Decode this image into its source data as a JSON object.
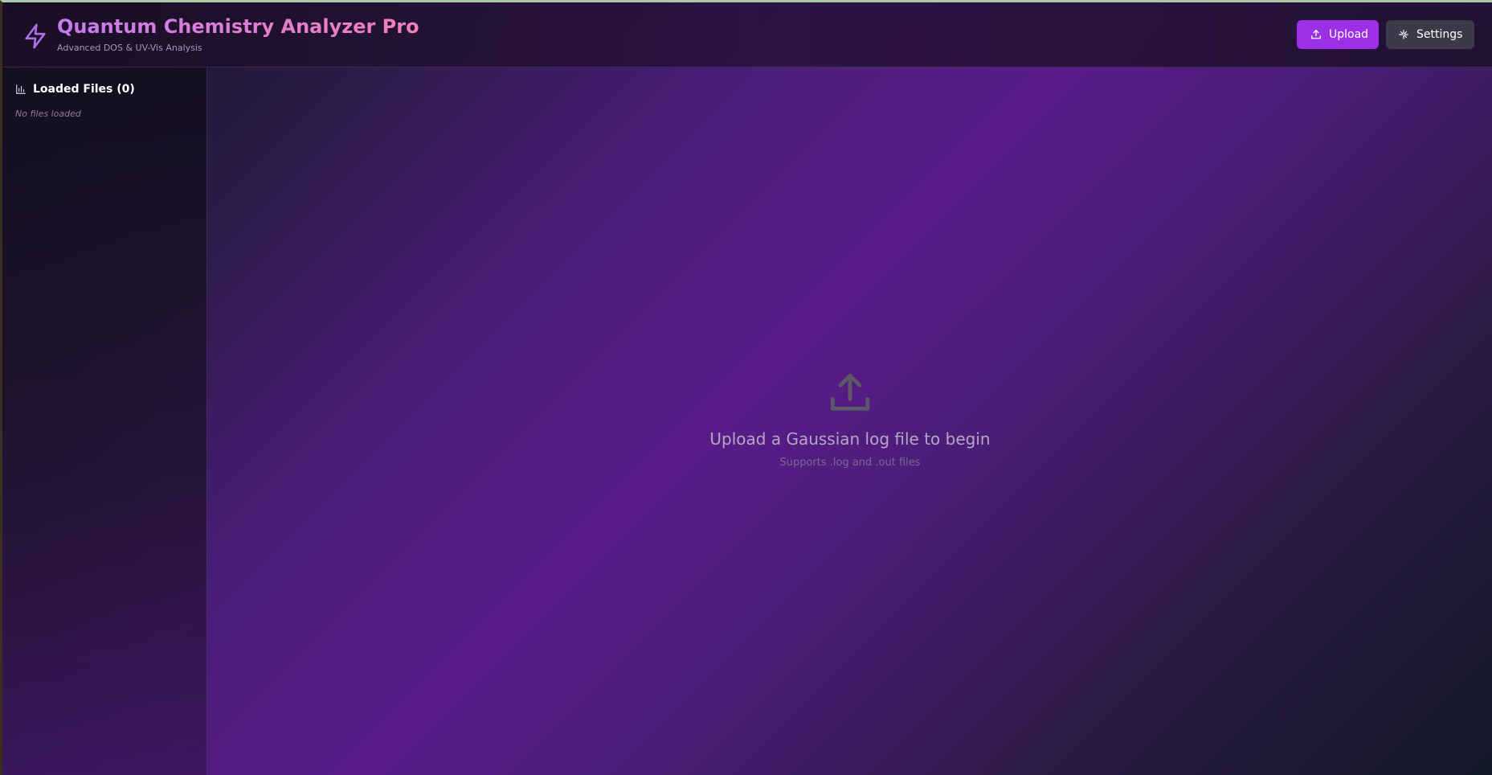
{
  "header": {
    "title": "Quantum Chemistry Analyzer Pro",
    "subtitle": "Advanced DOS & UV-Vis Analysis",
    "logo_icon": "lightning-bolt-icon",
    "upload_label": "Upload",
    "upload_icon": "upload-icon",
    "settings_label": "Settings",
    "settings_icon": "sparkle-icon"
  },
  "sidebar": {
    "heading": "Loaded Files (0)",
    "heading_icon": "bar-chart-icon",
    "empty_text": "No files loaded"
  },
  "main": {
    "empty_icon": "upload-icon",
    "empty_title": "Upload a Gaussian log file to begin",
    "empty_subtitle": "Supports .log and .out files"
  },
  "colors": {
    "accent": "#9b30e6",
    "title_gradient_start": "#c77bf0",
    "title_gradient_end": "#f27fb8",
    "settings_button": "#3a3a48"
  }
}
